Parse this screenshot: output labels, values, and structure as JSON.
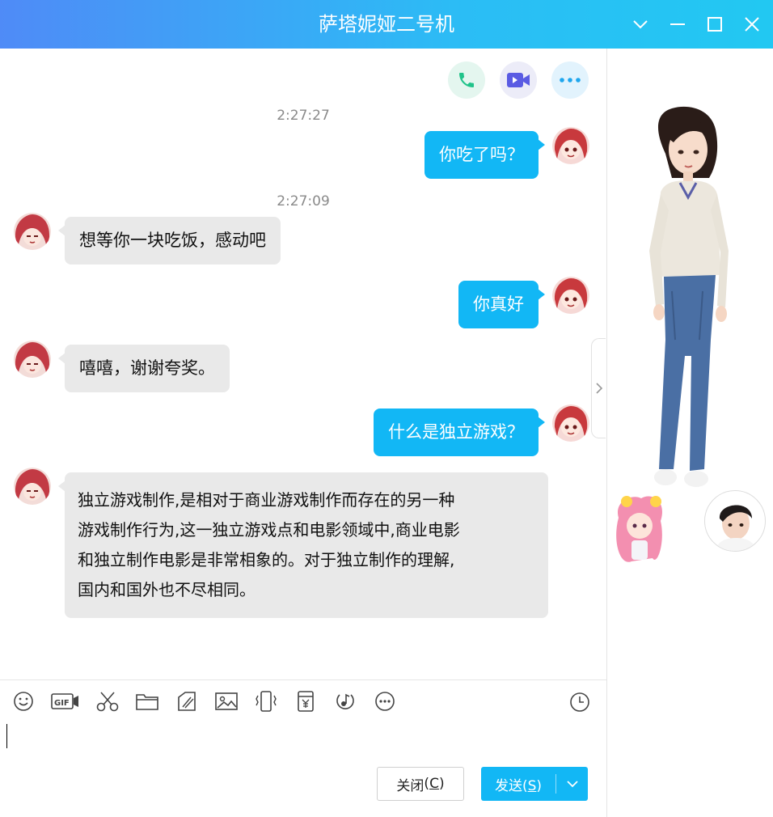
{
  "window": {
    "title": "萨塔妮娅二号机",
    "controls": [
      "chevron-down-icon",
      "minimize-icon",
      "maximize-icon",
      "close-icon"
    ]
  },
  "actions": [
    "phone-icon",
    "video-call-icon",
    "more-icon"
  ],
  "messages": [
    {
      "kind": "time",
      "text": "2:27:27"
    },
    {
      "kind": "me",
      "text": "你吃了吗？"
    },
    {
      "kind": "time",
      "text": "2:27:09"
    },
    {
      "kind": "bot",
      "text": "想等你一块吃饭，感动吧"
    },
    {
      "kind": "me",
      "text": "你真好"
    },
    {
      "kind": "bot",
      "text": "嘻嘻，谢谢夸奖。"
    },
    {
      "kind": "me",
      "text": "什么是独立游戏？"
    },
    {
      "kind": "bot",
      "lines": [
        "独立游戏制作,是相对于商业游戏制作而存在的另一种",
        "游戏制作行为,这一独立游戏点和电影领域中,商业电影",
        "和独立制作电影是非常相象的。对于独立制作的理解,",
        "国内和国外也不尽相同。"
      ]
    }
  ],
  "toolbar": {
    "tools": [
      "emoji-icon",
      "gif-icon",
      "screenshot-scissors-icon",
      "folder-icon",
      "doodle-icon",
      "image-icon",
      "shake-icon",
      "red-packet-icon",
      "music-icon",
      "more-tools-icon"
    ],
    "history": "history-clock-icon",
    "gif_text": "GIF"
  },
  "buttons": {
    "close": "关闭",
    "close_key": "C",
    "send": "发送",
    "send_key": "S"
  },
  "colors": {
    "accent": "#12b7f5",
    "title_gradient_start": "#4f8bf7",
    "title_gradient_end": "#22c8f2",
    "bot_bubble": "#e9e9e9"
  }
}
